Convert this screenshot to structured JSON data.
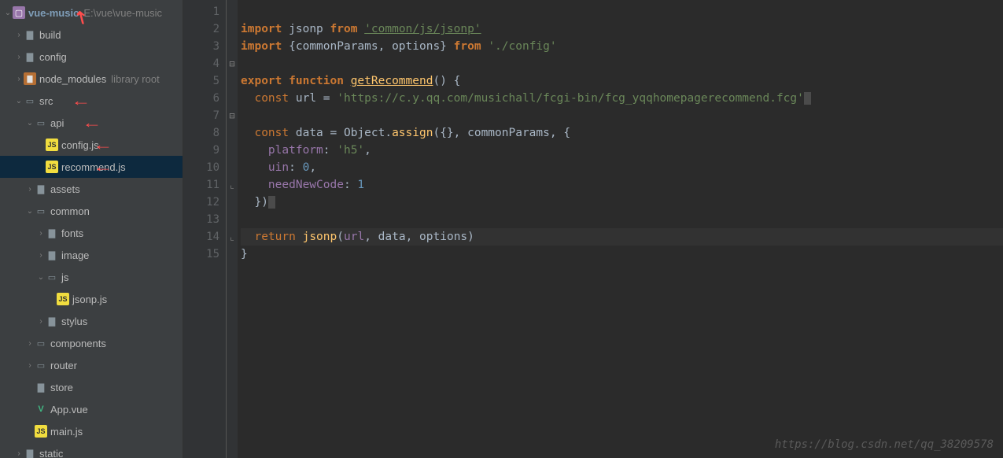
{
  "project": {
    "name": "vue-music",
    "path": "E:\\vue\\vue-music"
  },
  "tree": [
    {
      "label": "build",
      "icon": "folder",
      "indent": 1,
      "chev": "›"
    },
    {
      "label": "config",
      "icon": "folder",
      "indent": 1,
      "chev": "›"
    },
    {
      "label": "node_modules",
      "icon": "folder-red",
      "indent": 1,
      "chev": "›",
      "after": "library root"
    },
    {
      "label": "src",
      "icon": "folder-open",
      "indent": 1,
      "chev": "⌄",
      "arrow": true
    },
    {
      "label": "api",
      "icon": "folder-open",
      "indent": 2,
      "chev": "⌄",
      "arrow": true
    },
    {
      "label": "config.js",
      "icon": "js",
      "indent": 3,
      "chev": "",
      "arrow": true
    },
    {
      "label": "recommend.js",
      "icon": "js",
      "indent": 3,
      "chev": "",
      "selected": true,
      "arrow": true
    },
    {
      "label": "assets",
      "icon": "folder",
      "indent": 2,
      "chev": "›"
    },
    {
      "label": "common",
      "icon": "folder-open",
      "indent": 2,
      "chev": "⌄"
    },
    {
      "label": "fonts",
      "icon": "folder",
      "indent": 3,
      "chev": "›"
    },
    {
      "label": "image",
      "icon": "folder",
      "indent": 3,
      "chev": "›"
    },
    {
      "label": "js",
      "icon": "folder-open",
      "indent": 3,
      "chev": "⌄"
    },
    {
      "label": "jsonp.js",
      "icon": "js",
      "indent": 4,
      "chev": ""
    },
    {
      "label": "stylus",
      "icon": "folder",
      "indent": 3,
      "chev": "›"
    },
    {
      "label": "components",
      "icon": "folder-open",
      "indent": 2,
      "chev": "›"
    },
    {
      "label": "router",
      "icon": "folder-open",
      "indent": 2,
      "chev": "›"
    },
    {
      "label": "store",
      "icon": "folder",
      "indent": 2,
      "chev": ""
    },
    {
      "label": "App.vue",
      "icon": "vue",
      "indent": 2,
      "chev": ""
    },
    {
      "label": "main.js",
      "icon": "js",
      "indent": 2,
      "chev": ""
    },
    {
      "label": "static",
      "icon": "folder",
      "indent": 1,
      "chev": "›"
    }
  ],
  "lineNumbers": [
    "1",
    "2",
    "3",
    "4",
    "5",
    "6",
    "7",
    "8",
    "9",
    "10",
    "11",
    "12",
    "13",
    "14",
    "15"
  ],
  "foldMarks": [
    "",
    "",
    "",
    "⊟",
    "",
    "",
    "⊟",
    "",
    "",
    "",
    "⌞",
    "",
    "",
    "⌞",
    ""
  ],
  "code": {
    "l1": {
      "kw1": "import",
      "id": "jsonp",
      "kw2": "from",
      "str": "'common/js/jsonp'"
    },
    "l2": {
      "kw1": "import",
      "id": "{commonParams, options}",
      "kw2": "from",
      "str": "'./config'"
    },
    "l4": {
      "kw1": "export",
      "kw2": "function",
      "fn": "getRecommend",
      "rest": "() {"
    },
    "l5": {
      "kw": "const",
      "id": "url =",
      "str": "'https://c.y.qq.com/musichall/fcgi-bin/fcg_yqqhomepagerecommend.fcg'"
    },
    "l7": {
      "kw": "const",
      "id": "data = Object.",
      "fn": "assign",
      "rest": "({}, commonParams, {"
    },
    "l8": {
      "prop": "platform",
      "punct": ": ",
      "str": "'h5'",
      "comma": ","
    },
    "l9": {
      "prop": "uin",
      "punct": ": ",
      "num": "0",
      "comma": ","
    },
    "l10": {
      "prop": "needNewCode",
      "punct": ": ",
      "num": "1"
    },
    "l11": {
      "text": "})"
    },
    "l13": {
      "kw": "return",
      "fn": "jsonp",
      "open": "(",
      "arg1": "url",
      "c1": ", ",
      "arg2": "data",
      "c2": ", ",
      "arg3": "options",
      "close": ")"
    },
    "l14": {
      "text": "}"
    }
  },
  "watermark": "https://blog.csdn.net/qq_38209578"
}
